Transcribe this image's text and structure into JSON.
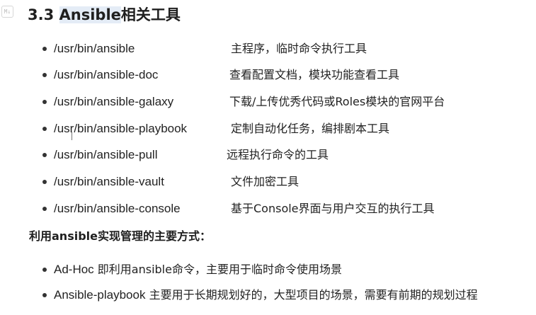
{
  "heading": {
    "number": "3.3",
    "highlight": "Ansible",
    "rest": "相关工具"
  },
  "tools": [
    {
      "path": "/usr/bin/ansible",
      "desc": "主程序，临时命令执行工具"
    },
    {
      "path": "/usr/bin/ansible-doc",
      "desc": "查看配置文档，模块功能查看工具"
    },
    {
      "path": "/usr/bin/ansible-galaxy",
      "desc": "下载/上传优秀代码或Roles模块的官网平台"
    },
    {
      "path": "/usr/bin/ansible-playbook",
      "desc": "定制自动化任务，编排剧本工具"
    },
    {
      "path": "/usr/bin/ansible-pull",
      "desc": "远程执行命令的工具"
    },
    {
      "path": "/usr/bin/ansible-vault",
      "desc": "文件加密工具"
    },
    {
      "path": "/usr/bin/ansible-console",
      "desc": "基于Console界面与用户交互的执行工具"
    }
  ],
  "subheading": "利用ansible实现管理的主要方式：",
  "modes": [
    {
      "name": "Ad-Hoc",
      "desc": "即利用ansible命令，主要用于临时命令使用场景"
    },
    {
      "name": "Ansible-playbook",
      "desc": "主要用于长期规划好的，大型项目的场景，需要有前期的规划过程"
    }
  ],
  "icons": {
    "block_marker": "markdown-block-icon"
  }
}
